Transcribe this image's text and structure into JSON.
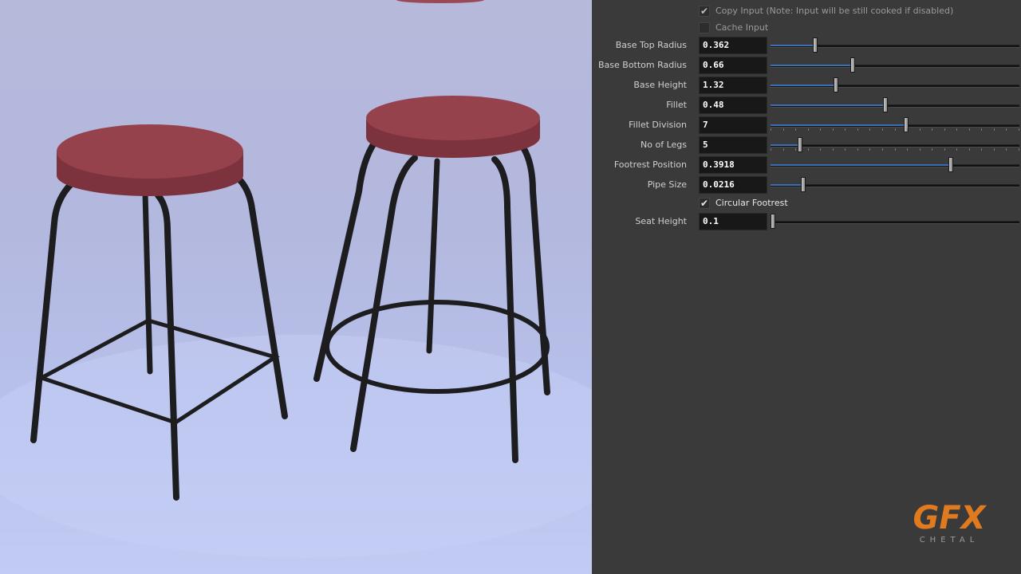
{
  "panel": {
    "copy_input": {
      "checked": true,
      "label": "Copy Input (Note: Input will be still cooked if disabled)"
    },
    "cache_input": {
      "checked": false,
      "label": "Cache Input"
    },
    "params": [
      {
        "label": "Base Top Radius",
        "value": "0.362",
        "slider_fraction": 0.18
      },
      {
        "label": "Base Bottom Radius",
        "value": "0.66",
        "slider_fraction": 0.33
      },
      {
        "label": "Base Height",
        "value": "1.32",
        "slider_fraction": 0.264
      },
      {
        "label": "Fillet",
        "value": "0.48",
        "slider_fraction": 0.46
      },
      {
        "label": "Fillet Division",
        "value": "7",
        "slider_fraction": 0.545
      },
      {
        "label": "No of Legs",
        "value": "5",
        "slider_fraction": 0.12
      },
      {
        "label": "Footrest Position",
        "value": "0.3918",
        "slider_fraction": 0.725
      },
      {
        "label": "Pipe Size",
        "value": "0.0216",
        "slider_fraction": 0.13
      }
    ],
    "circular_footrest": {
      "checked": true,
      "label": "Circular Footrest"
    },
    "seat_height": {
      "label": "Seat Height",
      "value": "0.1",
      "slider_fraction": 0.0
    }
  },
  "logo": {
    "mark": "GFX",
    "subtext": "CHETAL"
  },
  "colors": {
    "panel_bg": "#3a3a3a",
    "field_bg": "#181818",
    "slider_fill": "#3a6fb5",
    "seat": "#8a3a44",
    "logo_orange": "#e07a1f"
  }
}
